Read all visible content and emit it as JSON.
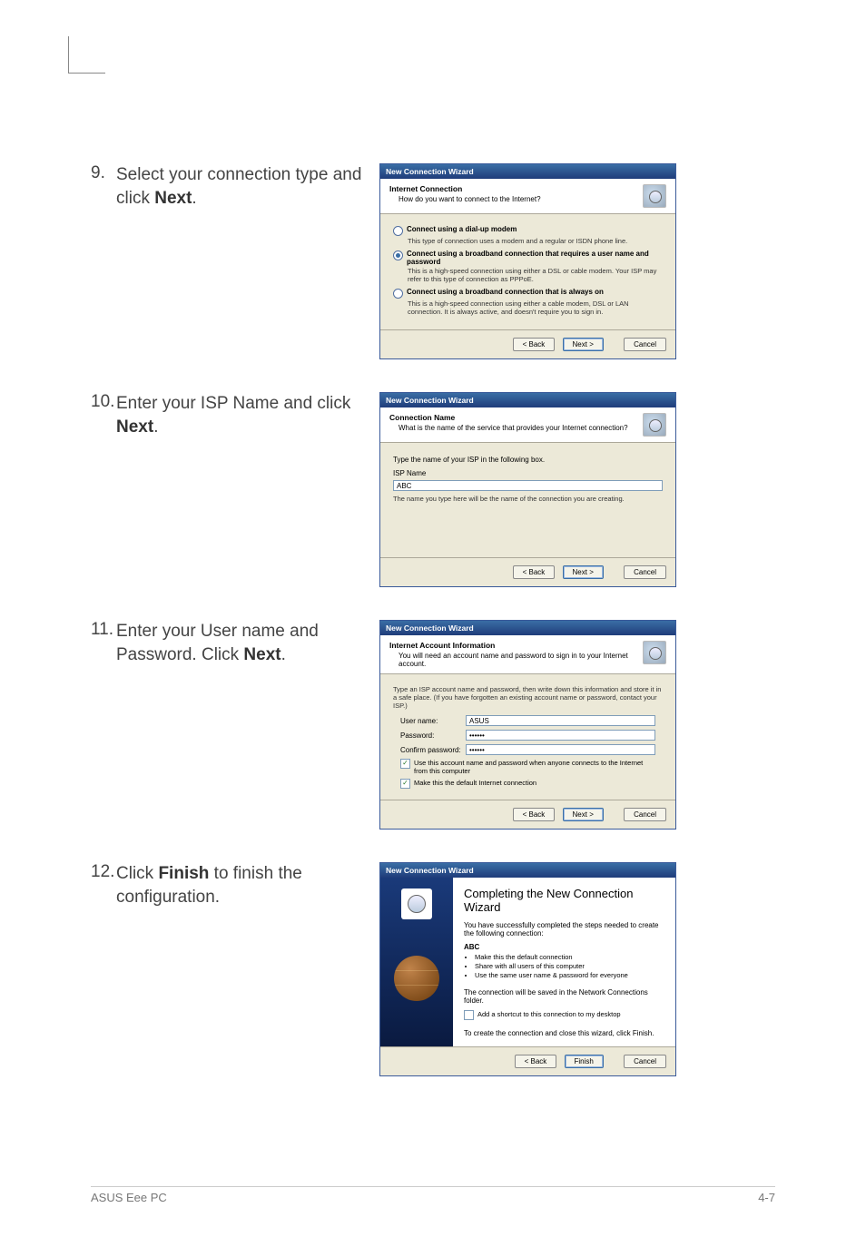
{
  "steps": {
    "s9": {
      "num": "9.",
      "text_before": "Select your connection type and click ",
      "bold": "Next",
      "text_after": "."
    },
    "s10": {
      "num": "10.",
      "text_before": "Enter your ISP Name and click ",
      "bold": "Next",
      "text_after": "."
    },
    "s11": {
      "num": "11.",
      "text_before": "Enter your User name and Password. Click ",
      "bold": "Next",
      "text_after": "."
    },
    "s12": {
      "num": "12.",
      "text_before_bold": "Click ",
      "bold": "Finish",
      "text_after_bold": " to finish the configuration."
    }
  },
  "wizard_common": {
    "title": "New Connection Wizard",
    "btn_back": "< Back",
    "btn_next": "Next >",
    "btn_cancel": "Cancel",
    "btn_finish": "Finish"
  },
  "dlg9": {
    "header_title": "Internet Connection",
    "header_sub": "How do you want to connect to the Internet?",
    "opt1_label": "Connect using a dial-up modem",
    "opt1_desc": "This type of connection uses a modem and a regular or ISDN phone line.",
    "opt2_label": "Connect using a broadband connection that requires a user name and password",
    "opt2_desc": "This is a high-speed connection using either a DSL or cable modem. Your ISP may refer to this type of connection as PPPoE.",
    "opt3_label": "Connect using a broadband connection that is always on",
    "opt3_desc": "This is a high-speed connection using either a cable modem, DSL or LAN connection. It is always active, and doesn't require you to sign in."
  },
  "dlg10": {
    "header_title": "Connection Name",
    "header_sub": "What is the name of the service that provides your Internet connection?",
    "prompt": "Type the name of your ISP in the following box.",
    "field_label": "ISP Name",
    "value": "ABC",
    "hint": "The name you type here will be the name of the connection you are creating."
  },
  "dlg11": {
    "header_title": "Internet Account Information",
    "header_sub": "You will need an account name and password to sign in to your Internet account.",
    "instr": "Type an ISP account name and password, then write down this information and store it in a safe place. (If you have forgotten an existing account name or password, contact your ISP.)",
    "user_label": "User name:",
    "user_value": "ASUS",
    "pass_label": "Password:",
    "pass_value": "••••••",
    "confirm_label": "Confirm password:",
    "confirm_value": "••••••",
    "chk1": "Use this account name and password when anyone connects to the Internet from this computer",
    "chk2": "Make this the default Internet connection"
  },
  "dlg12": {
    "finish_title": "Completing the New Connection Wizard",
    "line1": "You have successfully completed the steps needed to create the following connection:",
    "conn_name": "ABC",
    "b1": "Make this the default connection",
    "b2": "Share with all users of this computer",
    "b3": "Use the same user name & password for everyone",
    "line2": "The connection will be saved in the Network Connections folder.",
    "chk_shortcut": "Add a shortcut to this connection to my desktop",
    "line3": "To create the connection and close this wizard, click Finish."
  },
  "footer": {
    "left": "ASUS Eee PC",
    "right": "4-7"
  }
}
